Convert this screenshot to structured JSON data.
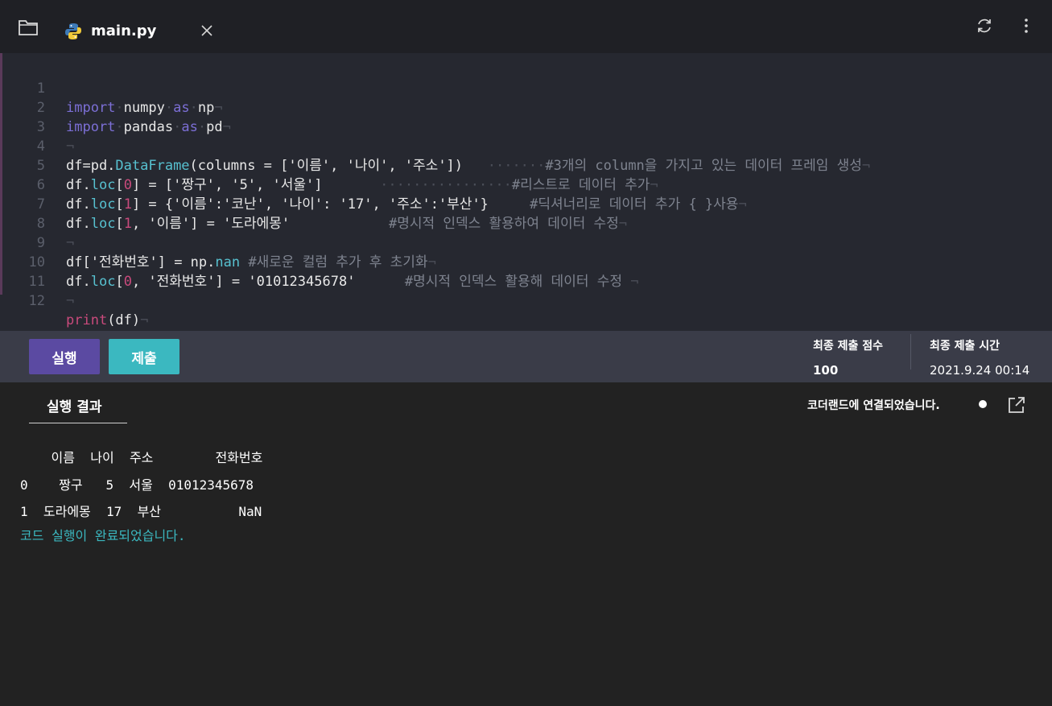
{
  "tab": {
    "title": "main.py",
    "icon": "python-icon"
  },
  "toolbar": {
    "refresh_icon": "refresh-icon",
    "more_icon": "more-vertical-icon",
    "folder_icon": "folder-icon"
  },
  "editor": {
    "lines": [
      {
        "num": "1"
      },
      {
        "num": "2"
      },
      {
        "num": "3"
      },
      {
        "num": "4"
      },
      {
        "num": "5"
      },
      {
        "num": "6"
      },
      {
        "num": "7"
      },
      {
        "num": "8"
      },
      {
        "num": "9"
      },
      {
        "num": "10"
      },
      {
        "num": "11"
      },
      {
        "num": "12"
      }
    ],
    "code": {
      "l1_kw1": "import",
      "l1_mod": "numpy",
      "l1_kw2": "as",
      "l1_alias": "np",
      "l2_kw1": "import",
      "l2_mod": "pandas",
      "l2_kw2": "as",
      "l2_alias": "pd",
      "l4_a": "df=pd.",
      "l4_fn": "DataFrame",
      "l4_b": "(columns = ['이름', '나이', '주소'])",
      "l4_cm": "#3개의 column을 가지고 있는 데이터 프레임 생성",
      "l5_a": "df.",
      "l5_fn": "loc",
      "l5_b": "[",
      "l5_n": "0",
      "l5_c": "] = ['짱구', '5', '서울']",
      "l5_cm": "#리스트로 데이터 추가",
      "l6_a": "df.",
      "l6_fn": "loc",
      "l6_b": "[",
      "l6_n": "1",
      "l6_c": "] = {'이름':'코난', '나이': '17', '주소':'부산'}",
      "l6_cm": "#딕셔너리로 데이터 추가 { }사용",
      "l7_a": "df.",
      "l7_fn": "loc",
      "l7_b": "[",
      "l7_n": "1",
      "l7_c": ", '이름'] = '도라에몽'",
      "l7_cm": "#명시적 인덱스 활용하여 데이터 수정",
      "l9_a": "df['전화번호'] = np.",
      "l9_fn": "nan",
      "l9_cm": "#새로운 컬럼 추가 후 초기화",
      "l10_a": "df.",
      "l10_fn": "loc",
      "l10_b": "[",
      "l10_n": "0",
      "l10_c": ", '전화번호'] = '01012345678'",
      "l10_cm": "#명시적 인덱스 활용해 데이터 수정 ",
      "l12_kw": "print",
      "l12_b": "(df)"
    }
  },
  "actions": {
    "run_label": "실행",
    "submit_label": "제출"
  },
  "score": {
    "label": "최종 제출 점수",
    "value": "100"
  },
  "time": {
    "label": "최종 제출 시간",
    "value": "2021.9.24 00:14"
  },
  "result": {
    "tab_label": "실행 결과",
    "connection": "코더랜드에 연결되었습니다.",
    "output_lines": [
      "    이름  나이  주소        전화번호",
      "0    짱구   5  서울  01012345678",
      "1  도라에몽  17  부산          NaN"
    ],
    "done": "코드 실행이 완료되었습니다."
  },
  "colors": {
    "keyword": "#7c6fd6",
    "function": "#57c1d0",
    "number": "#c94a7c",
    "run_button": "#5b4aa2",
    "submit_button": "#3bb8c0"
  }
}
